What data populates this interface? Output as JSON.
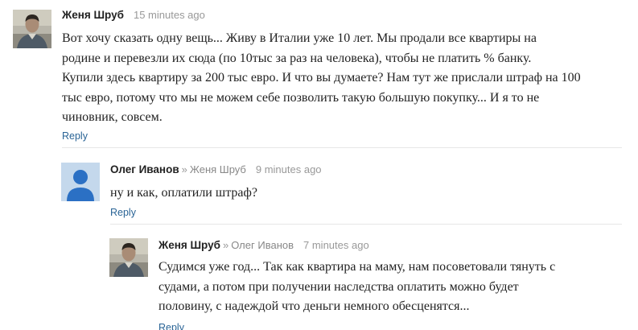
{
  "colors": {
    "link": "#2a6496",
    "meta": "#999999",
    "divider": "#e6e6e6",
    "default_avatar_bg": "#c4d8ec",
    "default_avatar_fg": "#2b70c4"
  },
  "comments": [
    {
      "author": "Женя Шруб",
      "reply_to": "",
      "time": "15 minutes ago",
      "avatar_icon": "user-photo-avatar",
      "lines": [
        "Вот хочу сказать одну вещь... Живу в Италии уже 10 лет. Мы продали все квартиры на",
        "родине и перевезли их сюда (по 10тыс за раз на человека), чтобы не платить % банку.",
        "Купили здесь квартиру за 200 тыс евро. И что вы думаете? Нам тут же прислали штраф на 100",
        "тыс евро, потому что мы не можем себе позволить такую большую покупку... И я то не",
        "чиновник, совсем."
      ],
      "reply_label": "Reply"
    },
    {
      "author": "Олег Иванов",
      "reply_to": "Женя Шруб",
      "arrow": "»",
      "time": "9 minutes ago",
      "avatar_icon": "default-user-avatar",
      "lines": [
        "ну и как, оплатили штраф?"
      ],
      "reply_label": "Reply"
    },
    {
      "author": "Женя Шруб",
      "reply_to": "Олег Иванов",
      "arrow": "»",
      "time": "7 minutes ago",
      "avatar_icon": "user-photo-avatar",
      "lines": [
        "Судимся уже год... Так как квартира на маму, нам посоветовали тянуть с",
        "судами, а потом при получении наследства оплатить можно будет",
        "половину, с надеждой что деньги немного обесценятся..."
      ],
      "reply_label": "Reply"
    }
  ]
}
